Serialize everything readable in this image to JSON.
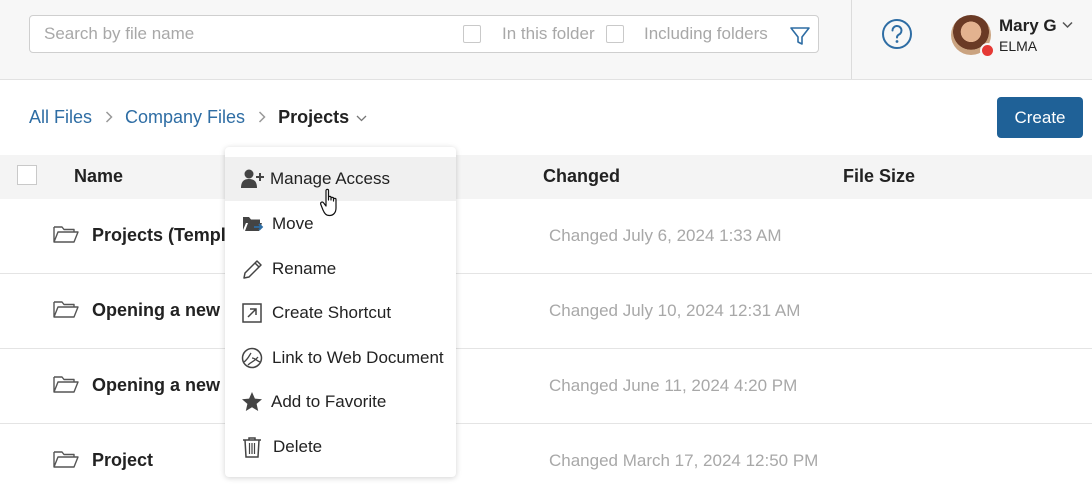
{
  "search": {
    "placeholder": "Search by file name",
    "in_this_folder_label": "In this folder",
    "including_folders_label": "Including folders"
  },
  "user": {
    "name": "Mary G",
    "org": "ELMA",
    "status_color": "#e53935"
  },
  "breadcrumb": {
    "items": [
      "All Files",
      "Company Files"
    ],
    "current": "Projects"
  },
  "toolbar": {
    "create_label": "Create"
  },
  "table": {
    "columns": {
      "name": "Name",
      "changed": "Changed",
      "file_size": "File Size"
    },
    "rows": [
      {
        "name": "Projects (Templa",
        "changed": "Changed July 6, 2024 1:33 AM"
      },
      {
        "name": "Opening a new b",
        "changed": "Changed July 10, 2024 12:31 AM"
      },
      {
        "name": "Opening a new b",
        "changed": "Changed June 11, 2024 4:20 PM"
      },
      {
        "name": "Project",
        "changed": "Changed March 17, 2024 12:50 PM"
      }
    ]
  },
  "context_menu": {
    "items": [
      {
        "label": "Manage Access",
        "icon": "add-user-icon"
      },
      {
        "label": "Move",
        "icon": "move-folder-icon"
      },
      {
        "label": "Rename",
        "icon": "pencil-icon"
      },
      {
        "label": "Create Shortcut",
        "icon": "shortcut-icon"
      },
      {
        "label": "Link to Web Document",
        "icon": "web-link-icon"
      },
      {
        "label": "Add to Favorite",
        "icon": "star-icon"
      },
      {
        "label": "Delete",
        "icon": "trash-icon"
      }
    ]
  },
  "colors": {
    "link": "#2e6da4",
    "primary_button": "#1f6197",
    "muted_text": "#a8a8a8",
    "icon_accent": "#2e6da4"
  }
}
